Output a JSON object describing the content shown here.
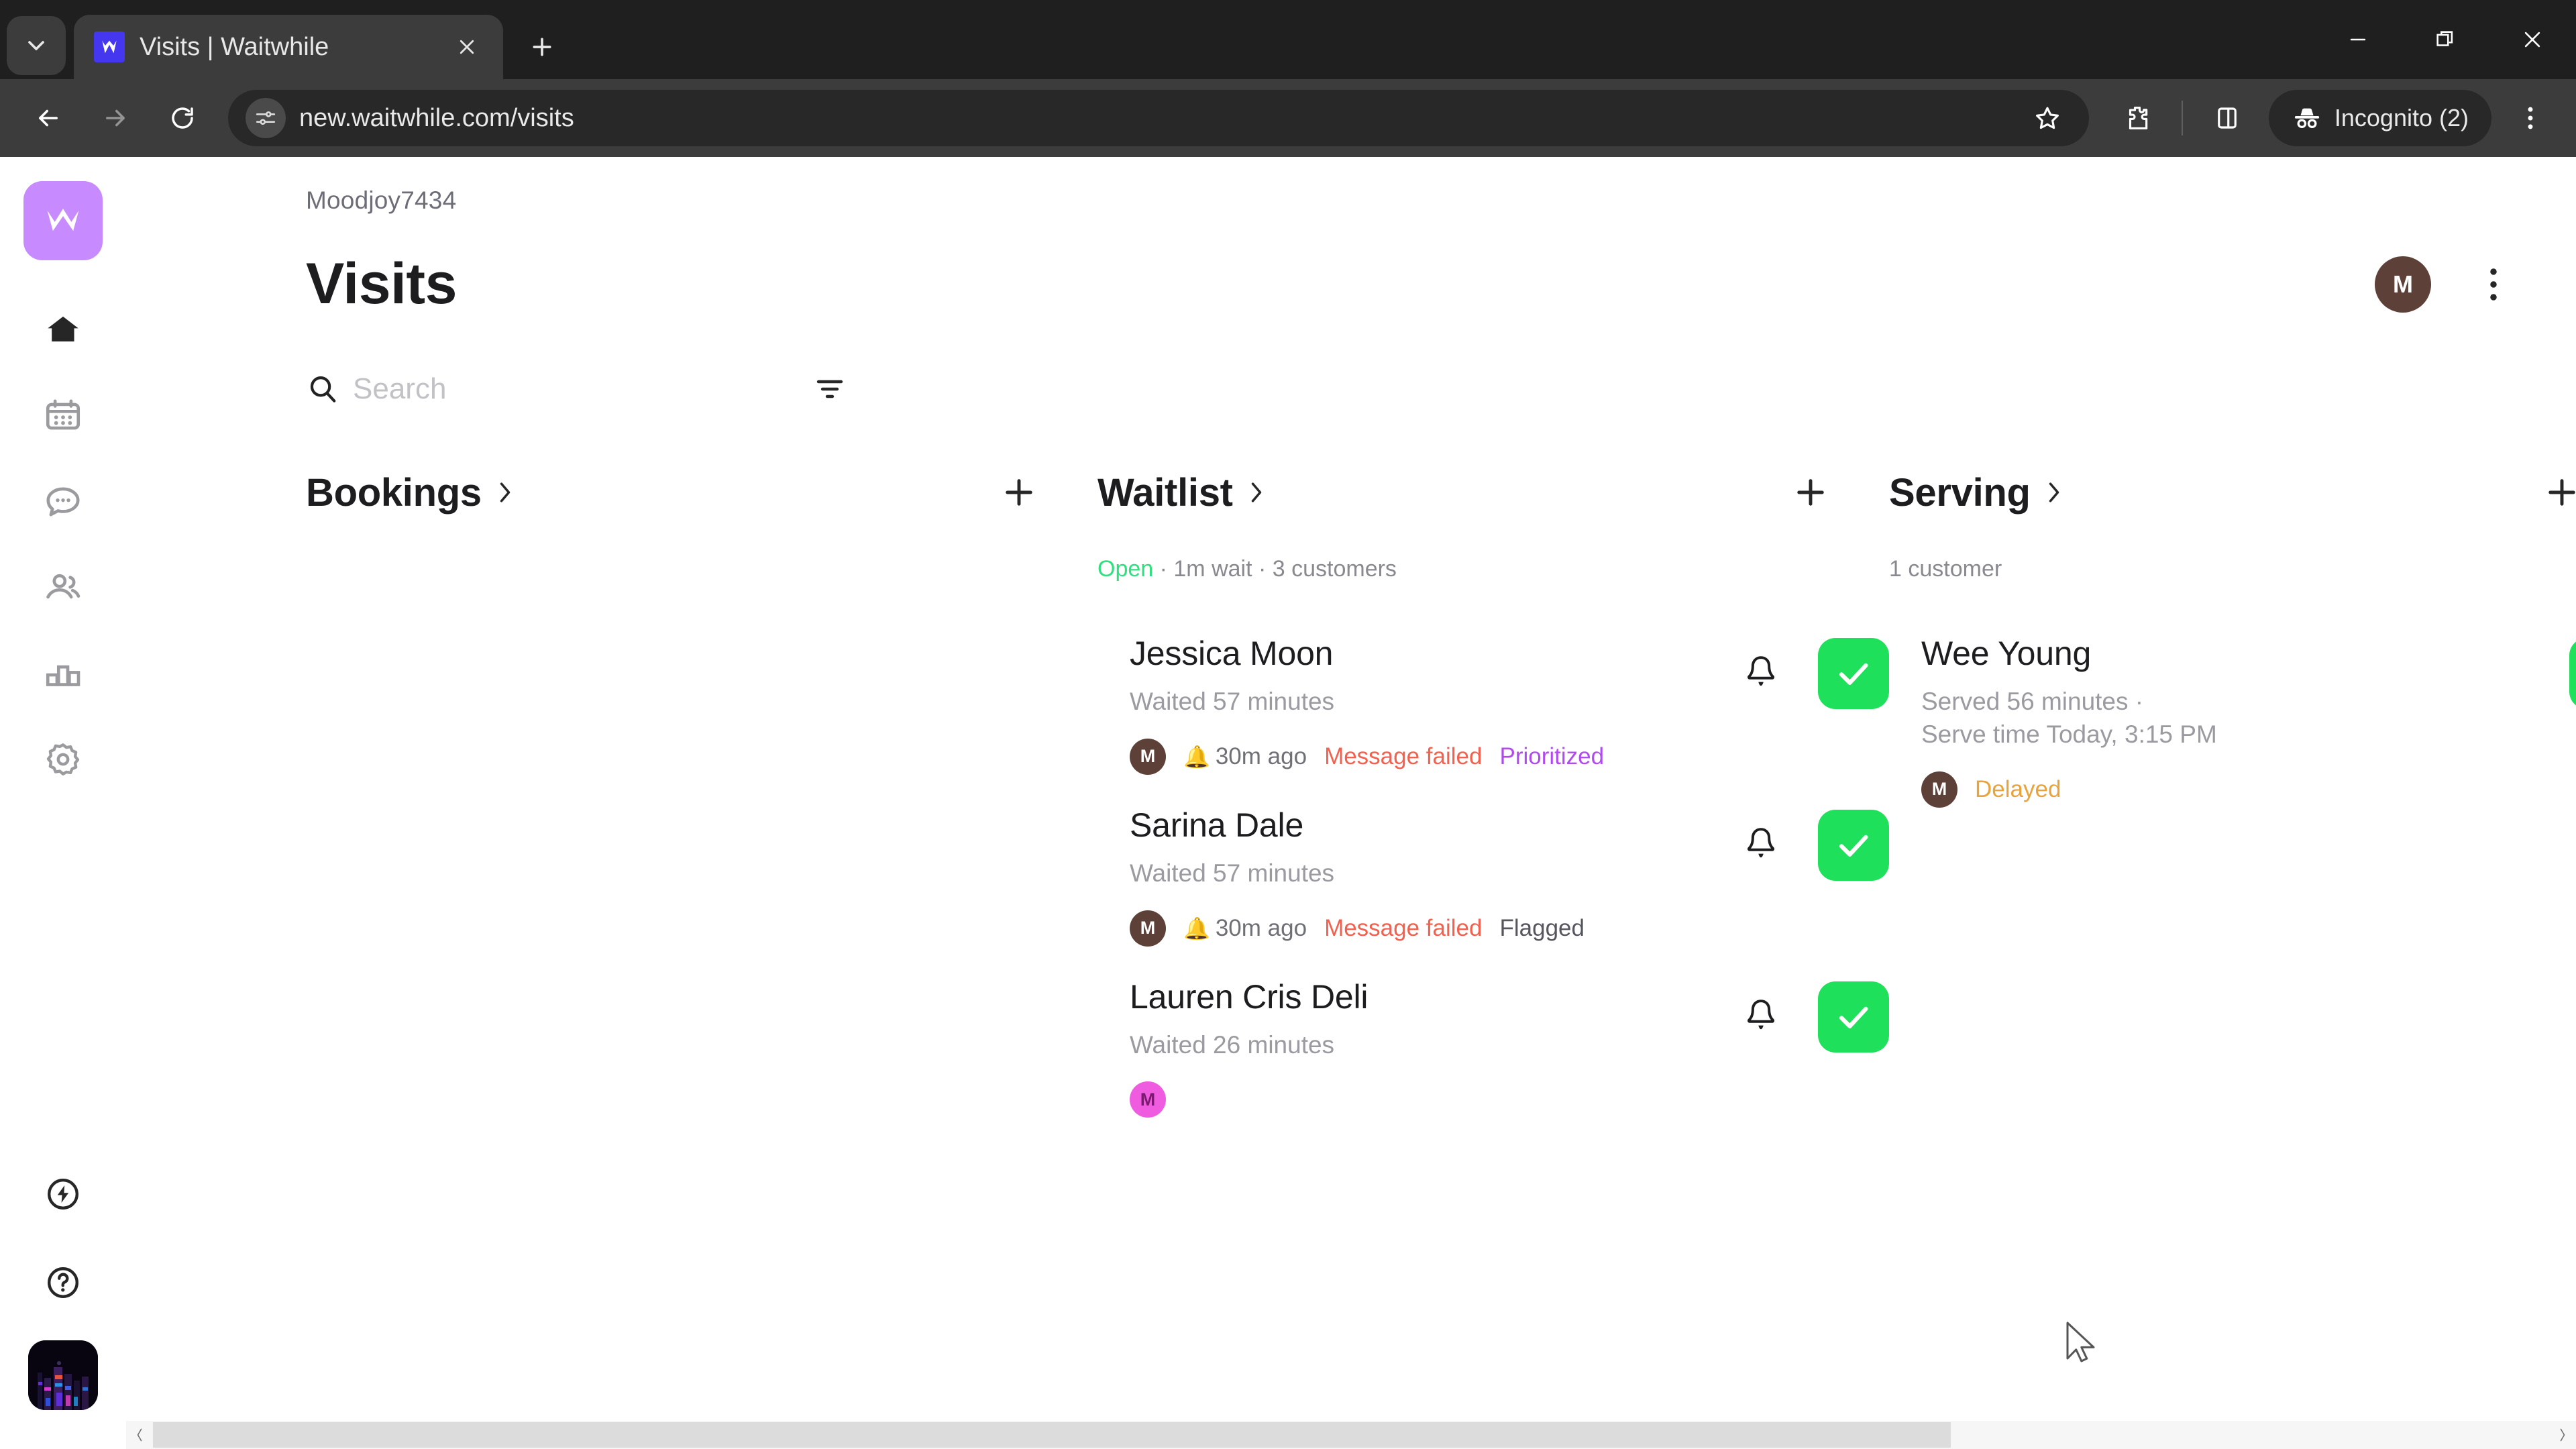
{
  "browser": {
    "tab": {
      "title": "Visits | Waitwhile",
      "favicon_name": "waitwhile-favicon",
      "close_label": "Close tab"
    },
    "new_tab_label": "New tab",
    "tab_search_label": "Search tabs",
    "window": {
      "minimize_label": "Minimize",
      "maximize_label": "Restore",
      "close_label": "Close"
    },
    "nav": {
      "back_label": "Back",
      "forward_label": "Forward",
      "reload_label": "Reload"
    },
    "omnibox": {
      "url": "new.waitwhile.com/visits",
      "site_info_label": "View site information"
    },
    "actions": {
      "bookmark_label": "Bookmark this tab",
      "extensions_label": "Extensions",
      "side_panel_label": "Side panel",
      "incognito_label": "Incognito (2)",
      "menu_label": "Customize and control Chrome"
    }
  },
  "sidebar": {
    "logo_letter": "M",
    "logo_color": "#c88bff",
    "items": [
      {
        "name": "home",
        "label": "Home",
        "active": true
      },
      {
        "name": "calendar",
        "label": "Calendar",
        "active": false
      },
      {
        "name": "messages",
        "label": "Messages",
        "active": false
      },
      {
        "name": "customers",
        "label": "Customers",
        "active": false
      },
      {
        "name": "analytics",
        "label": "Analytics",
        "active": false
      },
      {
        "name": "settings",
        "label": "Settings",
        "active": false
      }
    ],
    "bottom_items": [
      {
        "name": "power",
        "label": "Quick actions"
      },
      {
        "name": "help",
        "label": "Help"
      }
    ],
    "account_avatar_label": "Account photo"
  },
  "header": {
    "breadcrumb": "Moodjoy7434",
    "title": "Visits",
    "avatar_letter": "M",
    "avatar_color": "#5d4037",
    "more_label": "More options"
  },
  "search": {
    "placeholder": "Search",
    "value": "",
    "filter_label": "Filter"
  },
  "board": {
    "columns": [
      {
        "key": "bookings",
        "title": "Bookings",
        "meta": "",
        "meta_status": "",
        "add_label": "Add booking",
        "cards": []
      },
      {
        "key": "waitlist",
        "title": "Waitlist",
        "meta_status": "Open",
        "meta": " · 1m wait · 3 customers",
        "add_label": "Add to waitlist",
        "cards": [
          {
            "name": "Jessica Moon",
            "sub": "Waited 57 minutes",
            "avatar_letter": "M",
            "avatar_color": "#5d4037",
            "avatar_text_color": "#ffffff",
            "bell_emoji": "🔔",
            "time": "30m ago",
            "tags": [
              {
                "text": "Message failed",
                "style": "failed"
              },
              {
                "text": "Prioritized",
                "style": "priority"
              }
            ],
            "has_bell_button": true,
            "check_label": "Serve customer"
          },
          {
            "name": "Sarina Dale",
            "sub": "Waited 57 minutes",
            "avatar_letter": "M",
            "avatar_color": "#5d4037",
            "avatar_text_color": "#ffffff",
            "bell_emoji": "🔔",
            "time": "30m ago",
            "tags": [
              {
                "text": "Message failed",
                "style": "failed"
              },
              {
                "text": "Flagged",
                "style": "flagged"
              }
            ],
            "has_bell_button": true,
            "check_label": "Serve customer"
          },
          {
            "name": "Lauren Cris Deli",
            "sub": "Waited 26 minutes",
            "avatar_letter": "M",
            "avatar_color": "#f05ce0",
            "avatar_text_color": "#7a1a6e",
            "bell_emoji": "",
            "time": "",
            "tags": [],
            "has_bell_button": true,
            "check_label": "Serve customer"
          }
        ]
      },
      {
        "key": "serving",
        "title": "Serving",
        "meta_status": "",
        "meta": "1 customer",
        "add_label": "Add serving",
        "cards": [
          {
            "name": "Wee Young",
            "sub": "Served 56 minutes ·\nServe time Today, 3:15 PM",
            "avatar_letter": "M",
            "avatar_color": "#5d4037",
            "avatar_text_color": "#ffffff",
            "bell_emoji": "",
            "time": "",
            "tags": [
              {
                "text": "Delayed",
                "style": "delayed"
              }
            ],
            "has_bell_button": false,
            "check_label": "Complete visit"
          }
        ]
      }
    ]
  },
  "scrollbar": {
    "left_label": "Scroll left",
    "right_label": "Scroll right"
  },
  "colors": {
    "accent_green": "#1fe05a",
    "open_green": "#2fe07e",
    "failed_red": "#f4604e",
    "priority_purple": "#b04bee",
    "delayed_orange": "#e8a33d"
  }
}
